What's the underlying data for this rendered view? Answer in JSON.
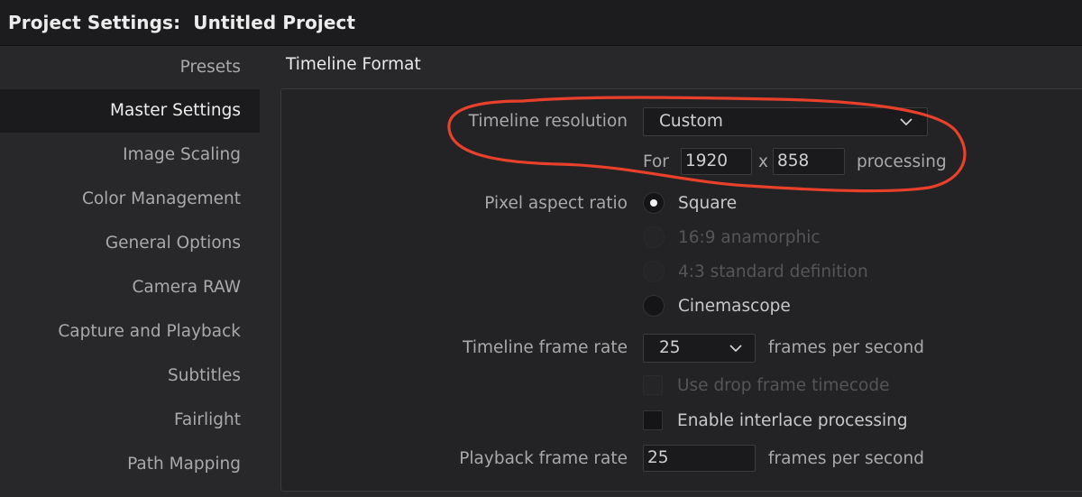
{
  "window": {
    "title": "Project Settings:  Untitled Project"
  },
  "sidebar": {
    "items": [
      {
        "label": "Presets"
      },
      {
        "label": "Master Settings",
        "active": true
      },
      {
        "label": "Image Scaling"
      },
      {
        "label": "Color Management"
      },
      {
        "label": "General Options"
      },
      {
        "label": "Camera RAW"
      },
      {
        "label": "Capture and Playback"
      },
      {
        "label": "Subtitles"
      },
      {
        "label": "Fairlight"
      },
      {
        "label": "Path Mapping"
      }
    ]
  },
  "section": {
    "title": "Timeline Format"
  },
  "timeline_resolution": {
    "label": "Timeline resolution",
    "selected": "Custom",
    "for_label": "For",
    "width": "1920",
    "x_label": "x",
    "height": "858",
    "processing_label": "processing"
  },
  "pixel_aspect": {
    "label": "Pixel aspect ratio",
    "options": [
      {
        "label": "Square",
        "state": "selected"
      },
      {
        "label": "16:9 anamorphic",
        "state": "disabled"
      },
      {
        "label": "4:3 standard definition",
        "state": "disabled"
      },
      {
        "label": "Cinemascope",
        "state": "enabled"
      }
    ]
  },
  "timeline_frame_rate": {
    "label": "Timeline frame rate",
    "selected": "25",
    "unit": "frames per second"
  },
  "drop_frame": {
    "label": "Use drop frame timecode",
    "checked": false,
    "disabled": true
  },
  "interlace": {
    "label": "Enable interlace processing",
    "checked": false,
    "disabled": false
  },
  "playback_frame_rate": {
    "label": "Playback frame rate",
    "value": "25",
    "unit": "frames per second"
  },
  "colors": {
    "background": "#28282b",
    "panel": "#232326",
    "annotation": "#e8402a"
  }
}
